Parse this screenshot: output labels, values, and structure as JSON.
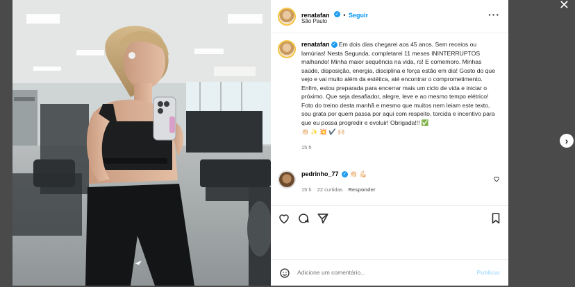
{
  "post": {
    "username": "renatafan",
    "follow_label": "Seguir",
    "location": "São Paulo",
    "caption": "Em dois dias chegarei aos 45 anos. Sem receios ou lamúrias! Nesta Segunda, completarei 11 meses ININTERRUPTOS malhando! Minha maior sequência na vida, rs! E comemoro. Minhas saúde, disposição, energia, disciplina e força estão em dia! Gosto do que vejo e vai muito além da estética, até encontrar o comprometimento. Enfim, estou preparada para encerrar mais um ciclo de vida e iniciar o próximo. Que seja desafiador, alegre, leve e ao mesmo tempo elétrico! Foto do treino desta manhã e mesmo que muitos nem leiam este texto, sou grata por quem passa por aqui com respeito, torcida e incentivo para que eu possa progredir e evoluir! Obrigada!!! ✅",
    "caption_emojis": "👏🏻 ✨ 💥 ✔️ 🙌🏻",
    "caption_time": "15 h"
  },
  "comment": {
    "username": "pedrinho_77",
    "text": "👏🏻 💪🏻",
    "time": "15 h",
    "likes": "22 curtidas",
    "reply_label": "Responder"
  },
  "compose": {
    "placeholder": "Adicione um comentário...",
    "publish_label": "Publicar"
  },
  "icons": {
    "close": "close-icon",
    "next": "chevron-right-icon",
    "like": "heart-icon",
    "comment": "comment-icon",
    "share": "send-icon",
    "save": "bookmark-icon",
    "emoji": "emoji-icon",
    "more": "more-icon"
  }
}
